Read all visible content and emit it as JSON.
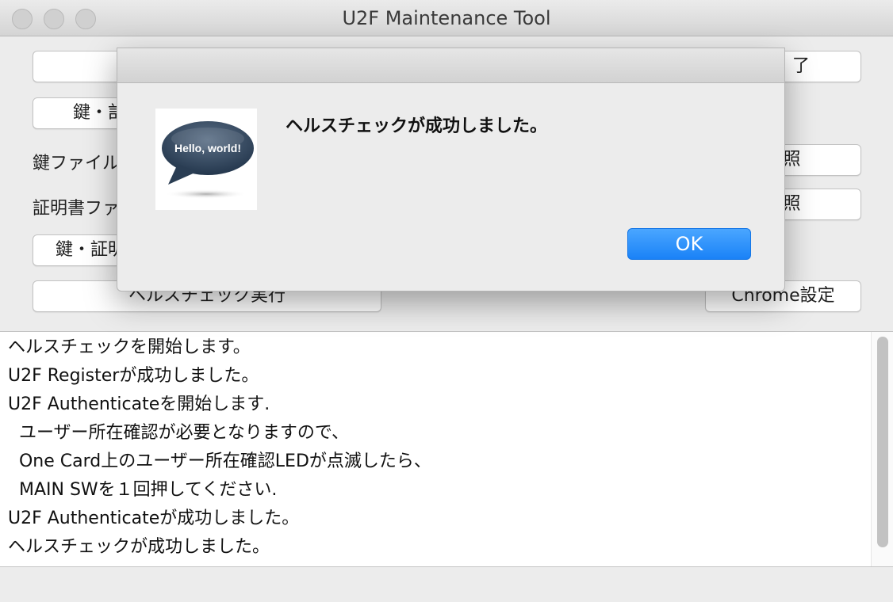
{
  "window": {
    "title": "U2F Maintenance Tool"
  },
  "main": {
    "top_button_right_partial": "了",
    "key_cert_install_partial": "鍵・訁",
    "key_file_label_partial": "鍵ファイル",
    "key_file_browse": "参照",
    "cert_file_label_partial": "証明書ファ",
    "cert_file_browse": "参照",
    "key_cert_delete_partial": "鍵・証明",
    "healthcheck_button": "ヘルスチェック実行",
    "chrome_settings_button": "Chrome設定"
  },
  "log": {
    "lines": [
      "ヘルスチェックを開始します。",
      "U2F Registerが成功しました。",
      "U2F Authenticateを開始します.",
      "  ユーザー所在確認が必要となりますので、",
      "  One Card上のユーザー所在確認LEDが点滅したら、",
      "  MAIN SWを１回押してください.",
      "U2F Authenticateが成功しました。",
      "ヘルスチェックが成功しました。"
    ]
  },
  "dialog": {
    "icon_name": "speech-bubble-icon",
    "icon_text": "Hello, world!",
    "message": "ヘルスチェックが成功しました。",
    "ok_label": "OK",
    "accent_color": "#1a82f7"
  }
}
